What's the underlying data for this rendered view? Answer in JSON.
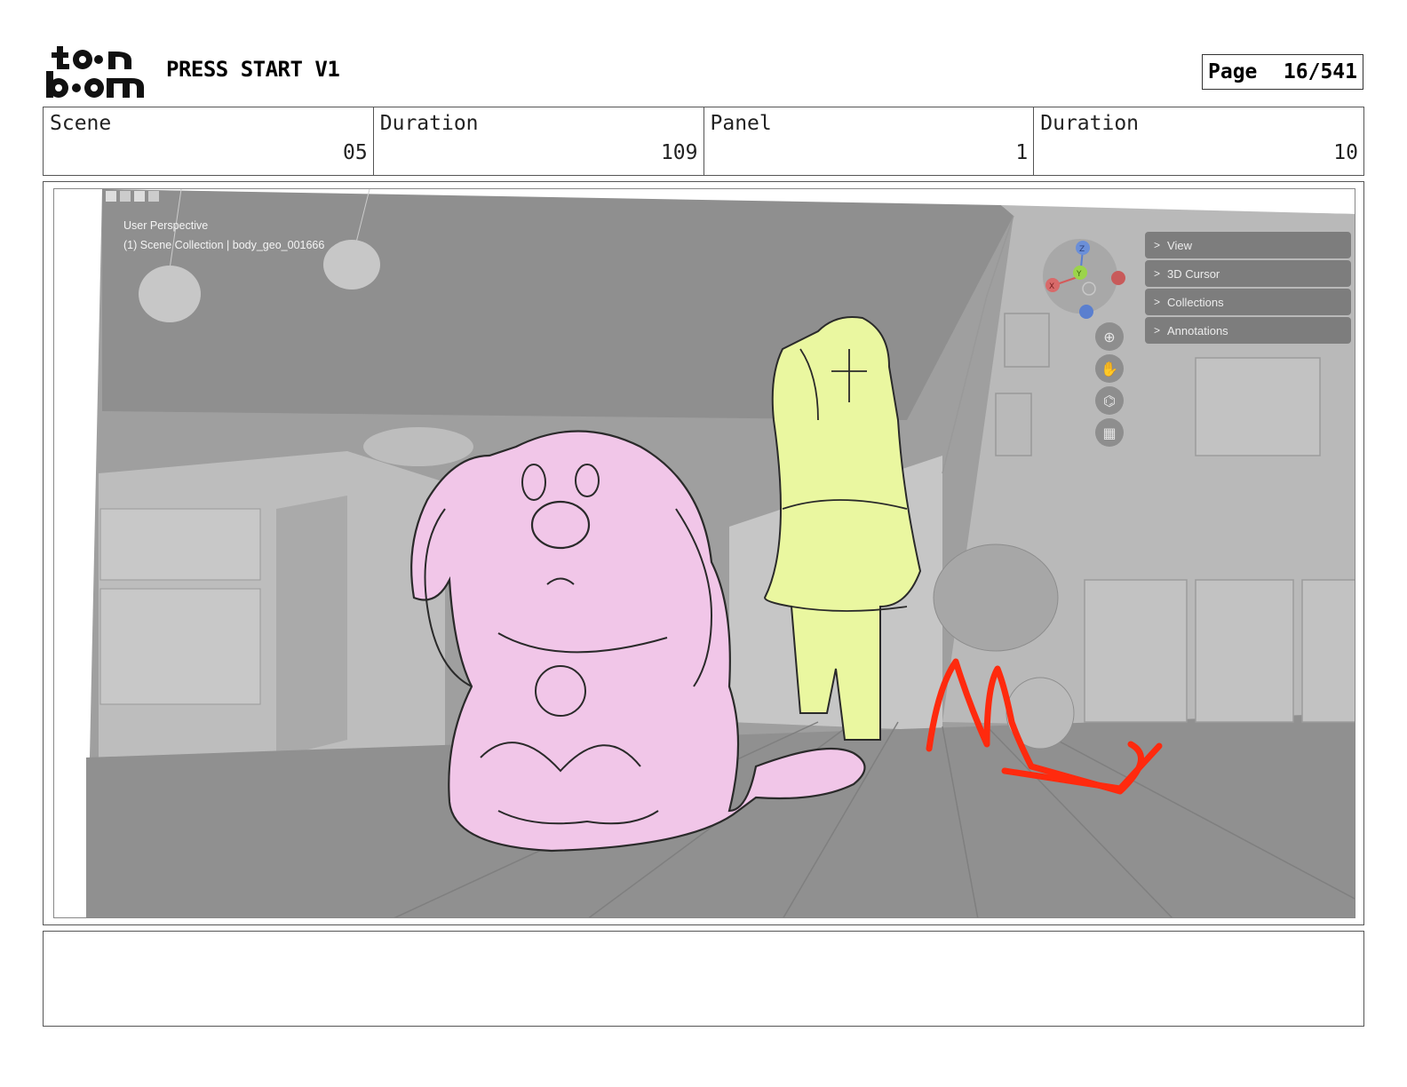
{
  "header": {
    "logo_text": "toon boom",
    "title": "PRESS START V1",
    "page_label": "Page",
    "page_value": "16/541"
  },
  "info": {
    "scene_label": "Scene",
    "scene_value": "05",
    "scene_duration_label": "Duration",
    "scene_duration_value": "109",
    "panel_label": "Panel",
    "panel_value": "1",
    "panel_duration_label": "Duration",
    "panel_duration_value": "10"
  },
  "viewport": {
    "perspective_label": "User Perspective",
    "collection_label": "(1) Scene Collection | body_geo_001666",
    "menus": [
      "View",
      "3D Cursor",
      "Collections",
      "Annotations"
    ],
    "gizmo_axes": [
      "Z",
      "Y",
      "X"
    ],
    "tools": [
      "zoom-icon",
      "hand-icon",
      "camera-icon",
      "grid-icon"
    ]
  },
  "colors": {
    "dog_fill": "#f1c6e8",
    "girl_fill": "#eaf7a0",
    "red_mark": "#ff2a0e",
    "bg_gray": "#a9a9a9"
  },
  "notes": {
    "text": ""
  }
}
